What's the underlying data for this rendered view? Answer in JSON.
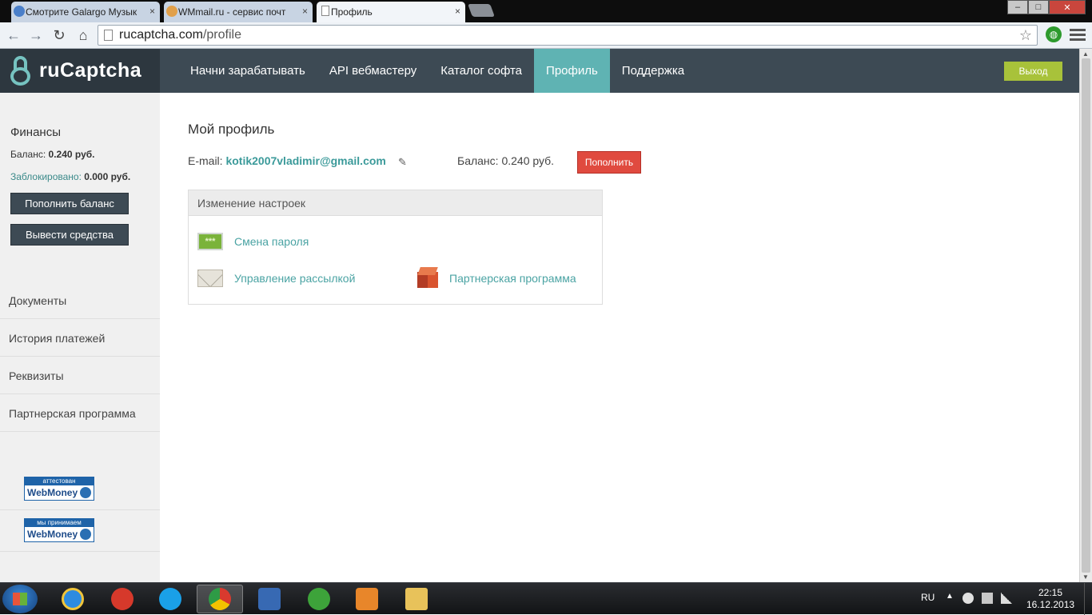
{
  "browser": {
    "tabs": [
      {
        "title": "Смотрите Galargo Музык",
        "active": false
      },
      {
        "title": "WMmail.ru - сервис почт",
        "active": false
      },
      {
        "title": "Профиль",
        "active": true
      }
    ],
    "tab_close": "×",
    "url_host": "rucaptcha.com",
    "url_path": "/profile",
    "win_minimize": "–",
    "win_maximize": "□",
    "win_close": "✕"
  },
  "header": {
    "logo": "ruCaptcha",
    "nav": [
      {
        "label": "Начни зарабатывать",
        "active": false
      },
      {
        "label": "API вебмастеру",
        "active": false
      },
      {
        "label": "Каталог софта",
        "active": false
      },
      {
        "label": "Профиль",
        "active": true
      },
      {
        "label": "Поддержка",
        "active": false
      }
    ],
    "logout": "Выход"
  },
  "sidebar": {
    "finance_title": "Финансы",
    "balance_label": "Баланс: ",
    "balance_value": "0.240 руб.",
    "blocked_label": "Заблокировано: ",
    "blocked_value": "0.000 руб.",
    "topup_button": "Пополнить баланс",
    "withdraw_button": "Вывести средства",
    "menu": [
      "Документы",
      "История платежей",
      "Реквизиты",
      "Партнерская программа"
    ],
    "badges": [
      {
        "top": "аттестован",
        "bottom": "WebMoney"
      },
      {
        "top": "мы принимаем",
        "bottom": "WebMoney"
      }
    ]
  },
  "main": {
    "title": "Мой профиль",
    "email_label": "E-mail: ",
    "email": "kotik2007vladimir@gmail.com",
    "balance_text": "Баланс: 0.240 руб.",
    "topup": "Пополнить",
    "settings_head": "Изменение настроек",
    "settings": {
      "password": "Смена пароля",
      "password_icon_text": "***",
      "mailing": "Управление рассылкой",
      "partner": "Партнерская программа"
    }
  },
  "taskbar": {
    "lang": "RU",
    "time": "22:15",
    "date": "16.12.2013"
  },
  "colors": {
    "header_bg": "#3d4a54",
    "accent_teal": "#5fb3b3",
    "logout_green": "#a8c23a",
    "topup_red": "#e04a3f"
  }
}
